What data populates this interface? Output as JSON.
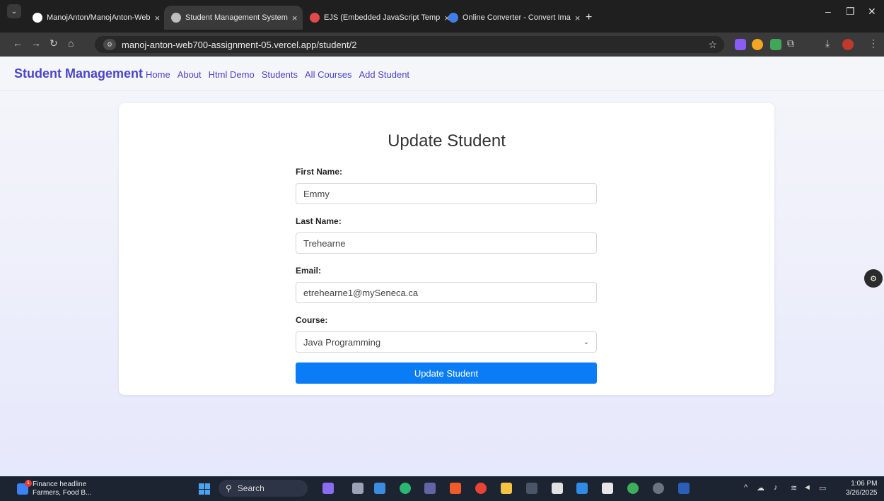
{
  "browser": {
    "tabs": [
      {
        "title": "ManojAnton/ManojAnton-Web",
        "close": "×",
        "favicon_color": "#ffffff"
      },
      {
        "title": "Student Management System",
        "close": "×",
        "favicon_color": "#bfbfbf"
      },
      {
        "title": "EJS (Embedded JavaScript Temp",
        "close": "×",
        "favicon_color": "#e24a4a"
      },
      {
        "title": "Online Converter - Convert Ima",
        "close": "×",
        "favicon_color": "#3f7ee8"
      }
    ],
    "new_tab": "+",
    "url": "manoj-anton-web700-assignment-05.vercel.app/student/2"
  },
  "navbar": {
    "brand": "Student Management",
    "links": [
      "Home",
      "About",
      "Html Demo",
      "Students",
      "All Courses",
      "Add Student"
    ]
  },
  "form": {
    "heading": "Update Student",
    "first_name_label": "First Name:",
    "first_name_value": "Emmy",
    "last_name_label": "Last Name:",
    "last_name_value": "Trehearne",
    "email_label": "Email:",
    "email_value": "etrehearne1@mySeneca.ca",
    "course_label": "Course:",
    "course_value": "Java Programming",
    "submit_label": "Update Student"
  },
  "taskbar": {
    "news_title": "Finance headline",
    "news_sub": "Farmers, Food B...",
    "news_badge": "1",
    "search": "Search",
    "time": "1:06 PM",
    "date": "3/26/2025"
  },
  "colors": {
    "accent": "#4b44c9",
    "button": "#0a7cf5"
  }
}
